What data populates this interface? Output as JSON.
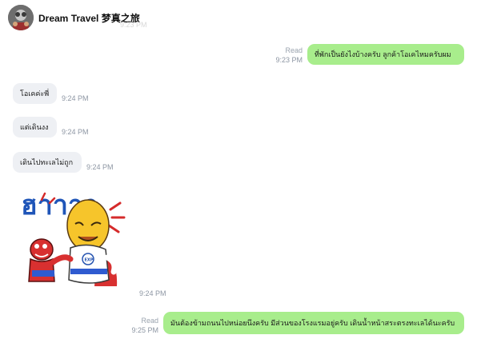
{
  "header": {
    "title": "Dream Travel 梦真之旅",
    "ghost_text": "9:23 PM"
  },
  "colors": {
    "outgoing_bubble": "#a8ed8c",
    "incoming_bubble": "#eef0f4",
    "meta_text": "#8d96a3"
  },
  "messages": [
    {
      "direction": "out",
      "text": "ที่พักเป็นยังไงบ้างครับ ลูกค้าโอเคไหมครับผม",
      "read_label": "Read",
      "time": "9:23 PM"
    },
    {
      "direction": "in",
      "text": "โอเคค่ะพี่",
      "time": "9:24 PM"
    },
    {
      "direction": "in",
      "text": "แต่เดินงง",
      "time": "9:24 PM"
    },
    {
      "direction": "in",
      "text": "เดินไปทะเลไม่ถูก",
      "time": "9:24 PM"
    },
    {
      "direction": "in",
      "type": "sticker",
      "sticker_text": "ฮาาาา",
      "sticker_badge": "EXP",
      "time": "9:24 PM"
    },
    {
      "direction": "out",
      "text": "มันต้องข้ามถนนไปหน่อยนึงครับ มีส่วนของโรงแรมอยู่ครับ เดินน้ำหน้าสระตรงทะเลได้นะครับ",
      "read_label": "Read",
      "time": "9:25 PM"
    }
  ]
}
